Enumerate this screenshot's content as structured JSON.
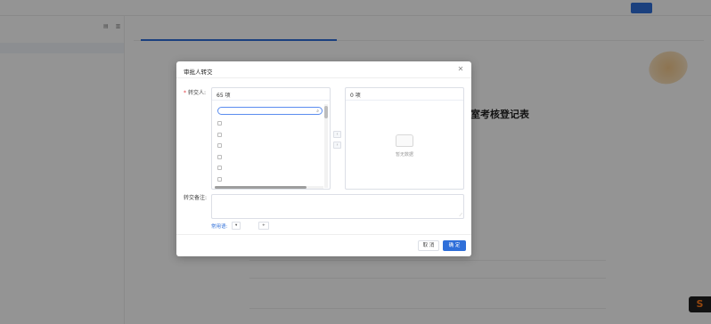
{
  "background": {
    "app_title": "",
    "nav": [
      "",
      "",
      ""
    ],
    "top_button": "",
    "top_links": [
      "",
      ""
    ],
    "sidebar_title": "",
    "sidebar_row": "",
    "tabs": [
      "",
      "",
      ""
    ],
    "doc_heading": "",
    "doc_link": "",
    "doc_meta": [
      "",
      ""
    ],
    "stamp_text": "",
    "doc_title": "室考核登记表",
    "cells": [
      "",
      "",
      "",
      "",
      "",
      "",
      "",
      "",
      ""
    ],
    "float_icon": "S"
  },
  "modal": {
    "title": "审批人转交",
    "close_icon": "close-icon",
    "field_label": "转交人:",
    "left_panel": {
      "count": "65 项",
      "search_placeholder": "",
      "options": [
        "",
        "",
        "",
        "",
        "",
        "",
        ""
      ]
    },
    "transfer_buttons": [
      "‹",
      "›"
    ],
    "right_panel": {
      "count": "0 项",
      "empty_text": "暂无数据"
    },
    "remark_label": "转交备注:",
    "remark_placeholder": "",
    "common_label": "常用语:",
    "common_tag": "",
    "add_common": "",
    "cancel": "取 消",
    "confirm": "确 定"
  },
  "colors": {
    "primary": "#2f6fd9",
    "required": "#e0393e",
    "overlay": "rgba(0,0,0,0.42)"
  }
}
